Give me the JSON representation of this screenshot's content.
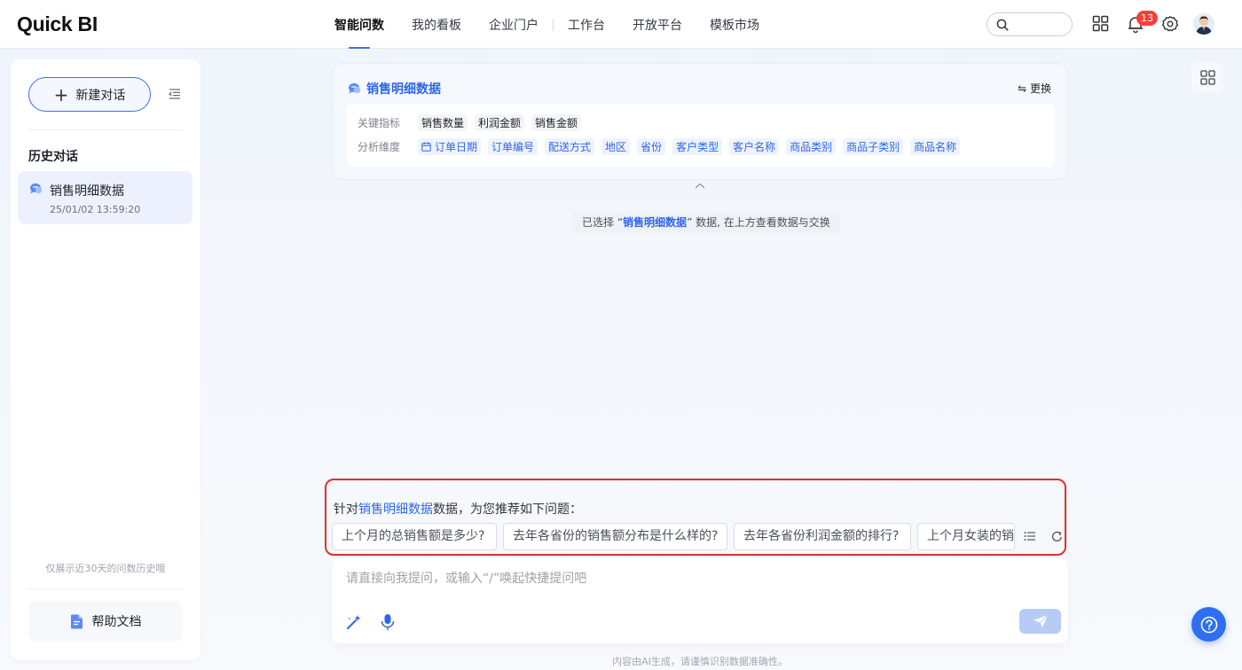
{
  "app": {
    "logo": "Quick BI"
  },
  "nav": {
    "items": [
      "智能问数",
      "我的看板",
      "企业门户",
      "工作台",
      "开放平台",
      "模板市场"
    ],
    "active": "智能问数"
  },
  "header": {
    "notification_count": "13"
  },
  "sidebar": {
    "new_chat_label": "新建对话",
    "history_title": "历史对话",
    "history": [
      {
        "title": "销售明细数据",
        "time": "25/01/02 13:59:20"
      }
    ],
    "history_note": "仅展示近30天的问数历史哦",
    "help_label": "帮助文档"
  },
  "dataset": {
    "name": "销售明细数据",
    "switch_label": "更换",
    "metrics_label": "关键指标",
    "metrics": [
      "销售数量",
      "利润金额",
      "销售金额"
    ],
    "dims_label": "分析维度",
    "dims": [
      "订单日期",
      "订单编号",
      "配送方式",
      "地区",
      "省份",
      "客户类型",
      "客户名称",
      "商品类别",
      "商品子类别",
      "商品名称"
    ]
  },
  "selected_note": {
    "prefix": "已选择 “",
    "name": "销售明细数据",
    "suffix": "” 数据, 在上方查看数据与交换"
  },
  "recommend": {
    "prefix": "针对",
    "dataset": "销售明细数据",
    "suffix": "数据，为您推荐如下问题：",
    "questions": [
      "上个月的总销售额是多少?",
      "去年各省份的销售额分布是什么样的?",
      "去年各省份利润金额的排行?",
      "上个月女装的销售"
    ]
  },
  "input": {
    "placeholder": "请直接向我提问，或输入“/”唤起快捷提问吧"
  },
  "disclaimer": "内容由AI生成，请谨慎识别数据准确性。",
  "colors": {
    "accent": "#3a6ff4",
    "link": "#2f66e8",
    "highlight_border": "#e0302b",
    "badge": "#f5403a"
  },
  "icons": [
    "search-icon",
    "apps-grid-icon",
    "bell-icon",
    "gear-icon",
    "avatar",
    "collapse-icon",
    "chat-bubble-icon",
    "document-icon",
    "swap-icon",
    "calendar-icon",
    "chevron-up-icon",
    "list-icon",
    "refresh-icon",
    "magic-wand-icon",
    "microphone-icon",
    "send-icon",
    "help-icon"
  ]
}
